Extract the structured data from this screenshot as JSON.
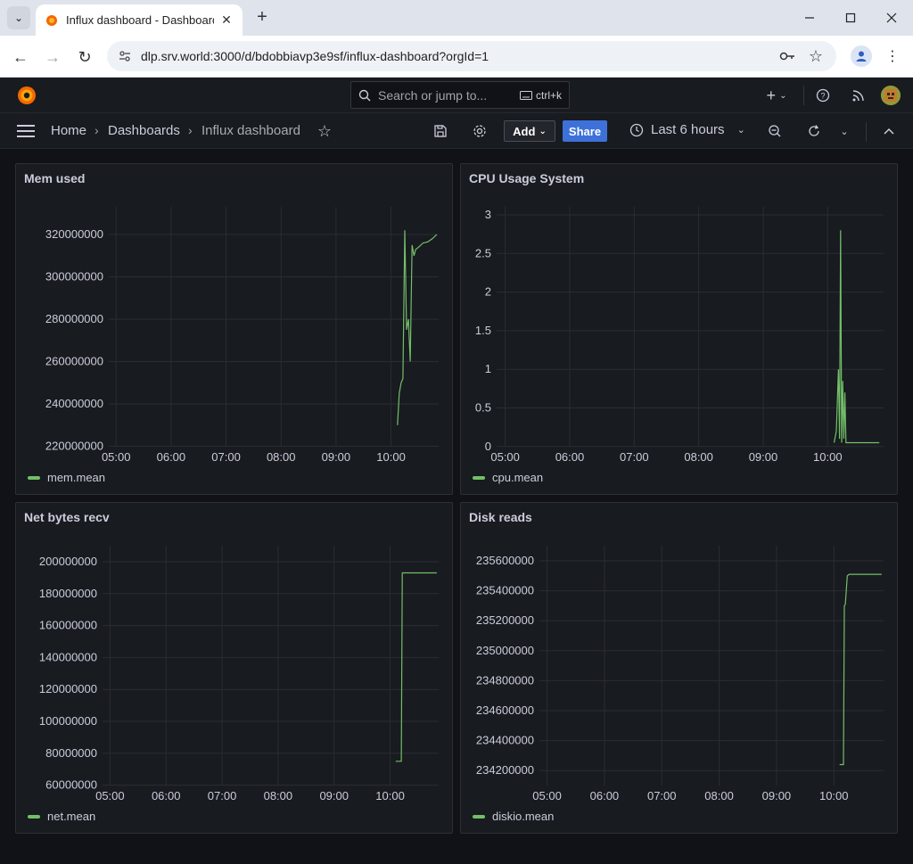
{
  "browser": {
    "tab_title": "Influx dashboard - Dashboards",
    "url": "dlp.srv.world:3000/d/bdobbiavp3e9sf/influx-dashboard?orgId=1",
    "icons": [
      "dropdown-icon",
      "close-icon",
      "plus-icon",
      "minimize-icon",
      "maximize-icon",
      "back-icon",
      "forward-icon",
      "reload-icon",
      "site-info-icon",
      "key-icon",
      "star-icon",
      "profile-icon",
      "kebab-icon"
    ]
  },
  "grafana": {
    "search_placeholder": "Search or jump to...",
    "search_shortcut": "ctrl+k",
    "breadcrumb": {
      "home": "Home",
      "dashboards": "Dashboards",
      "current": "Influx dashboard"
    },
    "add_label": "Add",
    "share_label": "Share",
    "time_range": "Last 6 hours",
    "accent_color": "#3d71d9",
    "series_color": "#73bf69"
  },
  "x_ticks": [
    "05:00",
    "06:00",
    "07:00",
    "08:00",
    "09:00",
    "10:00"
  ],
  "panels": [
    {
      "title": "Mem used",
      "legend": "mem.mean",
      "y_ticks": [
        "320000000",
        "300000000",
        "280000000",
        "260000000",
        "240000000",
        "220000000"
      ]
    },
    {
      "title": "CPU Usage System",
      "legend": "cpu.mean",
      "y_ticks": [
        "3",
        "2.5",
        "2",
        "1.5",
        "1",
        "0.5",
        "0"
      ]
    },
    {
      "title": "Net bytes recv",
      "legend": "net.mean",
      "y_ticks": [
        "200000000",
        "180000000",
        "160000000",
        "140000000",
        "120000000",
        "100000000",
        "80000000",
        "60000000"
      ]
    },
    {
      "title": "Disk reads",
      "legend": "diskio.mean",
      "y_ticks": [
        "235600000",
        "235400000",
        "235200000",
        "235000000",
        "234800000",
        "234600000",
        "234400000",
        "234200000"
      ]
    }
  ],
  "chart_data": [
    {
      "type": "line",
      "title": "Mem used",
      "series": [
        {
          "name": "mem.mean",
          "x": [
            "10:07",
            "10:09",
            "10:11",
            "10:13",
            "10:15",
            "10:17",
            "10:19",
            "10:21",
            "10:23",
            "10:25",
            "10:27",
            "10:30",
            "10:35",
            "10:40",
            "10:45",
            "10:50"
          ],
          "values": [
            230000000,
            245000000,
            250000000,
            252000000,
            322000000,
            275000000,
            280000000,
            260000000,
            315000000,
            310000000,
            313000000,
            314000000,
            316000000,
            316500000,
            318000000,
            320000000
          ]
        }
      ],
      "ylim": [
        220000000,
        330000000
      ]
    },
    {
      "type": "line",
      "title": "CPU Usage System",
      "series": [
        {
          "name": "cpu.mean",
          "x": [
            "10:06",
            "10:08",
            "10:10",
            "10:11",
            "10:12",
            "10:13",
            "10:14",
            "10:15",
            "10:16",
            "10:17",
            "10:18",
            "10:20",
            "10:30",
            "10:40",
            "10:48"
          ],
          "values": [
            0.05,
            0.2,
            1.0,
            0.1,
            2.8,
            0.05,
            0.85,
            0.1,
            0.7,
            0.05,
            0.05,
            0.05,
            0.05,
            0.05,
            0.05
          ]
        }
      ],
      "ylim": [
        0,
        3.2
      ]
    },
    {
      "type": "line",
      "title": "Net bytes recv",
      "series": [
        {
          "name": "net.mean",
          "x": [
            "10:06",
            "10:12",
            "10:13",
            "10:30",
            "10:50"
          ],
          "values": [
            75000000,
            75000000,
            193000000,
            193000000,
            193000000
          ]
        }
      ],
      "ylim": [
        60000000,
        205000000
      ]
    },
    {
      "type": "line",
      "title": "Disk reads",
      "series": [
        {
          "name": "diskio.mean",
          "x": [
            "10:06",
            "10:10",
            "10:11",
            "10:12",
            "10:14",
            "10:16",
            "10:30",
            "10:50"
          ],
          "values": [
            234240000,
            234240000,
            235300000,
            235310000,
            235500000,
            235510000,
            235510000,
            235510000
          ]
        }
      ],
      "ylim": [
        234150000,
        235650000
      ]
    }
  ]
}
